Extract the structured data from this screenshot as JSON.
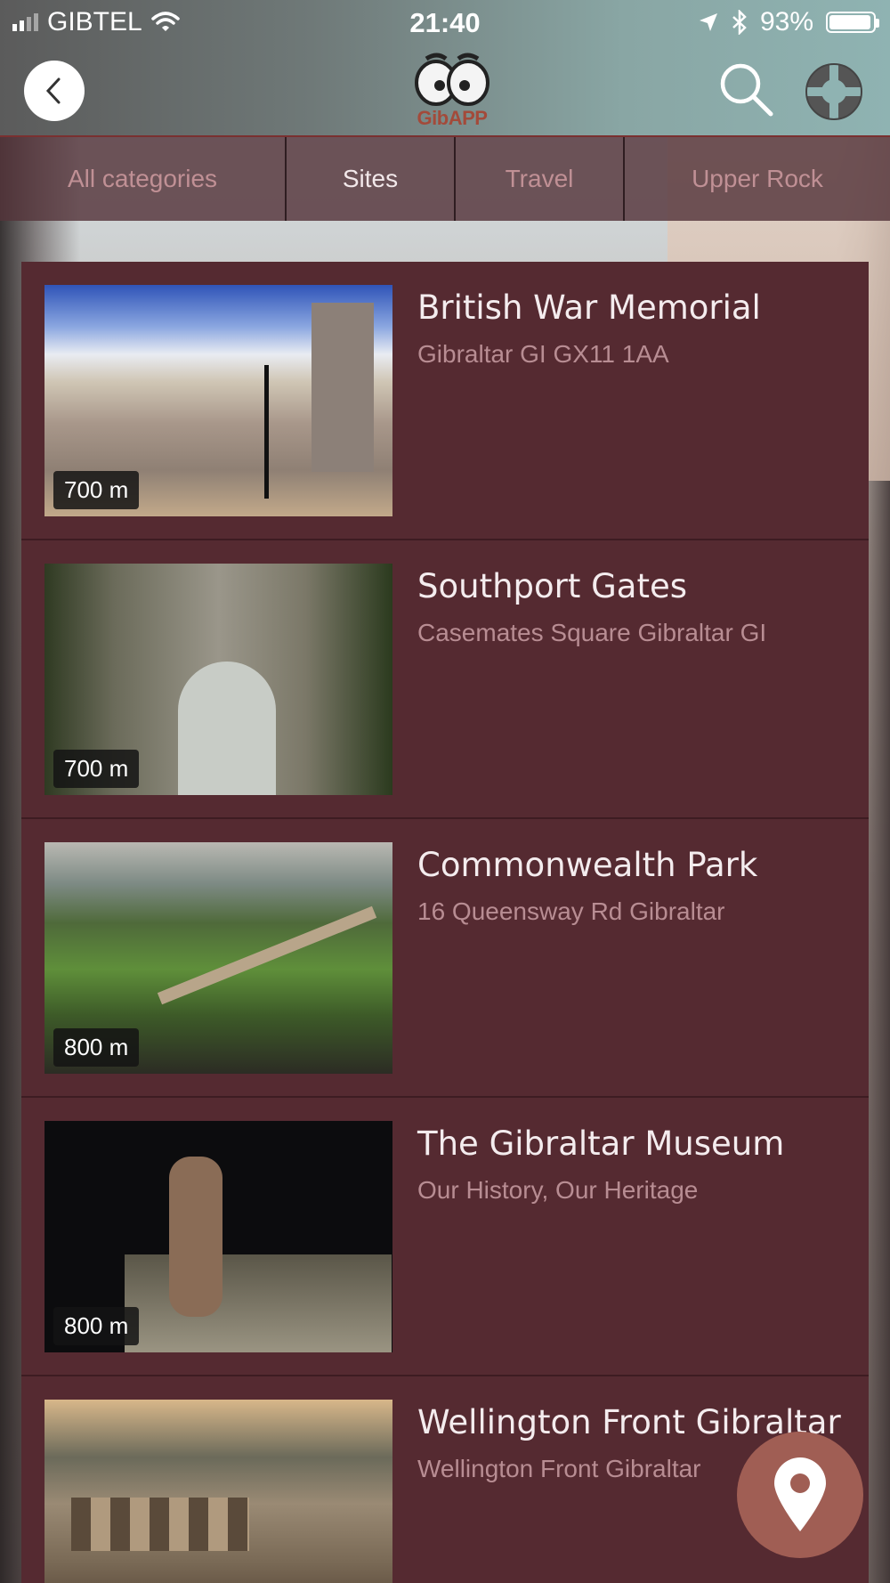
{
  "status_bar": {
    "carrier": "GIBTEL",
    "time": "21:40",
    "battery": "93%",
    "battery_level": 0.93
  },
  "header": {
    "logo_text": "GibAPP",
    "back_icon": "chevron-left-icon",
    "search_icon": "search-icon",
    "help_icon": "lifebuoy-icon"
  },
  "tabs": [
    {
      "label": "All categories",
      "active": false
    },
    {
      "label": "Sites",
      "active": true
    },
    {
      "label": "Travel",
      "active": false
    },
    {
      "label": "Upper Rock",
      "active": false
    }
  ],
  "places": [
    {
      "title": "British War Memorial",
      "subtitle": "Gibraltar GI GX11 1AA",
      "distance": "700 m"
    },
    {
      "title": "Southport Gates",
      "subtitle": "Casemates Square Gibraltar GI",
      "distance": "700 m"
    },
    {
      "title": "Commonwealth Park",
      "subtitle": "16 Queensway Rd Gibraltar",
      "distance": "800 m"
    },
    {
      "title": "The Gibraltar Museum",
      "subtitle": "Our History, Our Heritage",
      "distance": "800 m"
    },
    {
      "title": "Wellington Front Gibraltar",
      "subtitle": "Wellington Front Gibraltar",
      "distance": ""
    }
  ],
  "fab": {
    "icon": "map-pin-icon"
  },
  "colors": {
    "list_bg": "#552a31",
    "tab_bg": "#54343a",
    "fab_bg": "#a05e54",
    "title_text": "#f4ecee",
    "subtitle_text": "#b88d93"
  }
}
